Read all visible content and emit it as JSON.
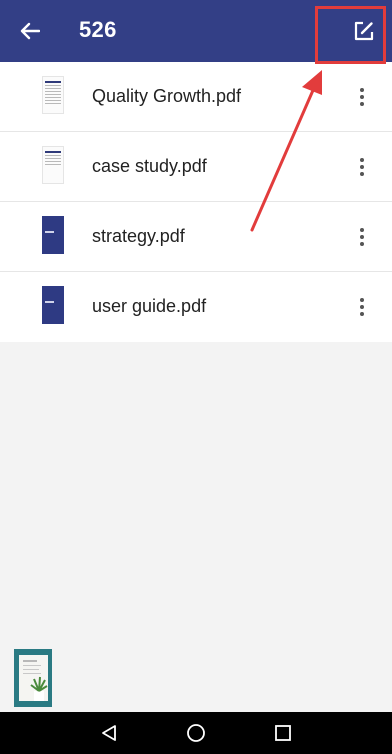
{
  "appbar": {
    "title": "526",
    "back_icon": "arrow-left-icon",
    "edit_icon": "edit-square-icon",
    "color": "#333f86"
  },
  "files": [
    {
      "name": "Quality Growth.pdf",
      "thumb": "doc"
    },
    {
      "name": "case study.pdf",
      "thumb": "doc"
    },
    {
      "name": "strategy.pdf",
      "thumb": "blue"
    },
    {
      "name": "user guide.pdf",
      "thumb": "blue"
    }
  ],
  "annotation": {
    "color": "#e23c3c"
  },
  "navbar": {
    "back_icon": "triangle-back-icon",
    "home_icon": "circle-home-icon",
    "recents_icon": "square-recents-icon"
  }
}
